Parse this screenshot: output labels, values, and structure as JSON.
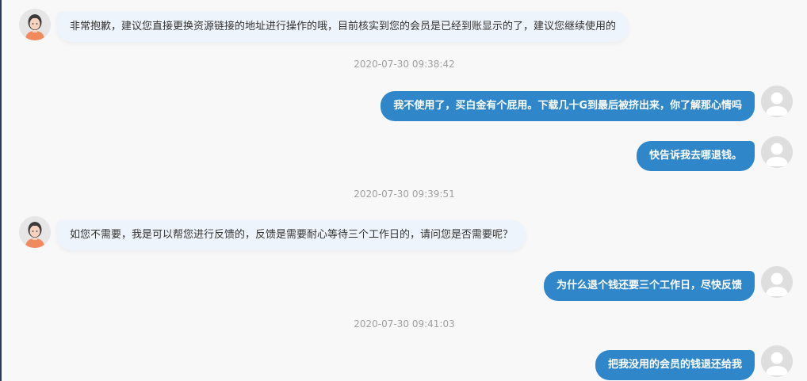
{
  "chat": {
    "messages": [
      {
        "sender": "agent",
        "text": "非常抱歉，建议您直接更换资源链接的地址进行操作的哦，目前核实到您的会员是已经到账显示的了，建议您继续使用的"
      },
      {
        "timestamp": "2020-07-30 09:38:42"
      },
      {
        "sender": "user",
        "text": "我不使用了，买白金有个屁用。下载几十G到最后被挤出来，你了解那心情吗"
      },
      {
        "sender": "user",
        "text": "快告诉我去哪退钱。"
      },
      {
        "timestamp": "2020-07-30 09:39:51"
      },
      {
        "sender": "agent",
        "text": "如您不需要，我是可以帮您进行反馈的，反馈是需要耐心等待三个工作日的，请问您是否需要呢？"
      },
      {
        "sender": "user",
        "text": "为什么退个钱还要三个工作日，尽快反馈"
      },
      {
        "timestamp": "2020-07-30 09:41:03"
      },
      {
        "sender": "user",
        "text": "把我没用的会员的钱退还给我"
      }
    ]
  },
  "colors": {
    "agent_bubble": "#eef4fb",
    "user_bubble": "#2f86c9",
    "timestamp_text": "#a0a0a0"
  },
  "icons": {
    "agent_avatar": "agent-avatar-icon",
    "user_avatar": "user-avatar-icon"
  }
}
